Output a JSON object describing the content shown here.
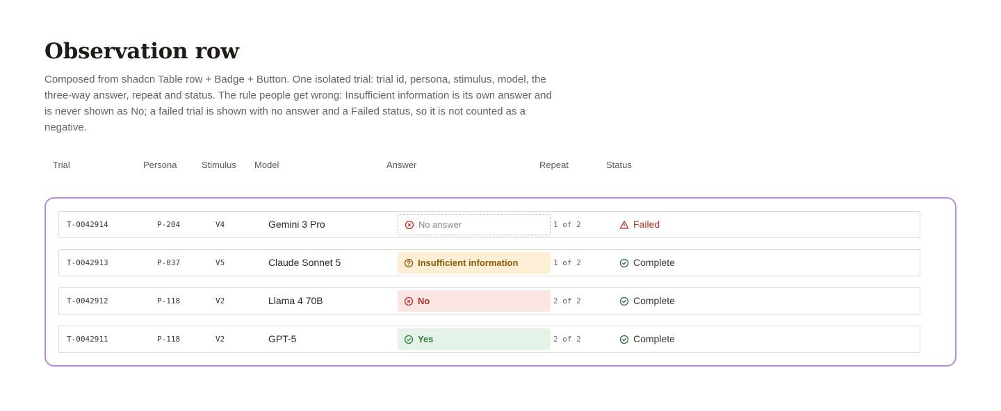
{
  "header": {
    "title": "Observation row",
    "description": "Composed from shadcn Table row + Badge + Button. One isolated trial: trial id, persona, stimulus, model, the three-way answer, repeat and status. The rule people get wrong: Insufficient information is its own answer and is never shown as No; a failed trial is shown with no answer and a Failed status, so it is not counted as a negative."
  },
  "table": {
    "columns": {
      "trial": "Trial",
      "persona": "Persona",
      "stimulus": "Stimulus",
      "model": "Model",
      "answer": "Answer",
      "repeat": "Repeat",
      "status": "Status"
    },
    "rows": [
      {
        "trial": "T-0042914",
        "persona": "P-204",
        "stimulus": "V4",
        "model": "Gemini 3 Pro",
        "answer": "No answer",
        "answer_kind": "none",
        "repeat": "1 of 2",
        "status": "Failed",
        "status_kind": "failed"
      },
      {
        "trial": "T-0042913",
        "persona": "P-037",
        "stimulus": "V5",
        "model": "Claude Sonnet 5",
        "answer": "Insufficient information",
        "answer_kind": "insufficient",
        "repeat": "1 of 2",
        "status": "Complete",
        "status_kind": "complete"
      },
      {
        "trial": "T-0042912",
        "persona": "P-118",
        "stimulus": "V2",
        "model": "Llama 4 70B",
        "answer": "No",
        "answer_kind": "no",
        "repeat": "2 of 2",
        "status": "Complete",
        "status_kind": "complete"
      },
      {
        "trial": "T-0042911",
        "persona": "P-118",
        "stimulus": "V2",
        "model": "GPT-5",
        "answer": "Yes",
        "answer_kind": "yes",
        "repeat": "2 of 2",
        "status": "Complete",
        "status_kind": "complete"
      }
    ]
  },
  "colors": {
    "frame_accent": "#b58ed6",
    "failed": "#b0302b",
    "insufficient_bg": "#fcefd6",
    "no_bg": "#fae5e3",
    "yes_bg": "#e5f2e8"
  },
  "icons": {
    "none": "x-circle-icon",
    "insufficient": "question-circle-icon",
    "no": "x-circle-icon",
    "yes": "check-circle-icon",
    "failed": "warning-triangle-icon",
    "complete": "check-circle-icon"
  }
}
